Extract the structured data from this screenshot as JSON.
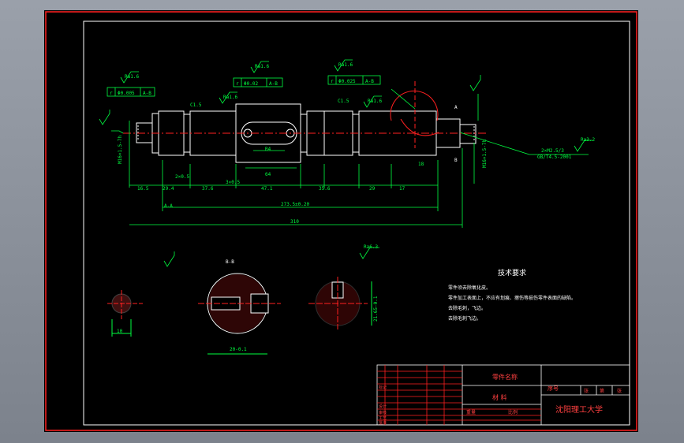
{
  "drawing": {
    "view_labels": {
      "section_aa": "A-A",
      "section_bb": "B-B"
    },
    "roughness_marks": [
      "Ra1.6",
      "Ra1.6",
      "Ra1.6",
      "Ra1.6",
      "Ra1.6",
      "Ra3.2",
      "Ra3.2",
      "Ra3.2",
      "Ra3.2",
      "Ra6.3"
    ],
    "tolerance_frames": {
      "left": [
        "r",
        "Φ0.005",
        "A-B"
      ],
      "mid": [
        "r",
        "Φ0.02",
        "A-B"
      ],
      "right": [
        "r",
        "Φ0.025",
        "A-B"
      ]
    },
    "chamfers": [
      "C1.5",
      "C1.5"
    ],
    "datums": [
      "A",
      "B"
    ],
    "dims": {
      "d1": "16.5",
      "d2": "29.4",
      "d3": "37.6",
      "d4": "3×0.5",
      "d5": "47.1",
      "d6": "35.6",
      "d7": "29",
      "d8": "17",
      "d9": "2×0.5",
      "d10": "64",
      "d11": "R4",
      "d12": "A-A",
      "overall_mid": "273.5±0.20",
      "overall": "310",
      "d13": "18",
      "thread_left": "M16×1.5-7h",
      "thread_right": "M16×1.5-7h",
      "thread_note1": "2×M2.5/3",
      "thread_note2": "GB/T4.5-2001",
      "sec_w1": "10",
      "sec_w2": "20-0.1",
      "sec_d": "21.65-0.1",
      "sec_bb": "2"
    },
    "tech_req": {
      "title": "技术要求",
      "items": [
        "零件须去除氧化皮。",
        "零件加工表面上，不应有划痕、擦伤等损伤零件表面的缺陷。",
        "去除毛刺，飞边。",
        "去除毛刺飞边。"
      ]
    },
    "title_block": {
      "part_name": "零件名称",
      "material": "材 料",
      "seq": "序号",
      "school": "沈阳理工大学",
      "sheets": [
        "张",
        "第",
        "张"
      ],
      "row_labels": [
        "标记",
        "设计",
        "审核",
        "工艺",
        "标准化",
        "批准"
      ],
      "scale_label": "比例",
      "weight_label": "重量"
    }
  }
}
